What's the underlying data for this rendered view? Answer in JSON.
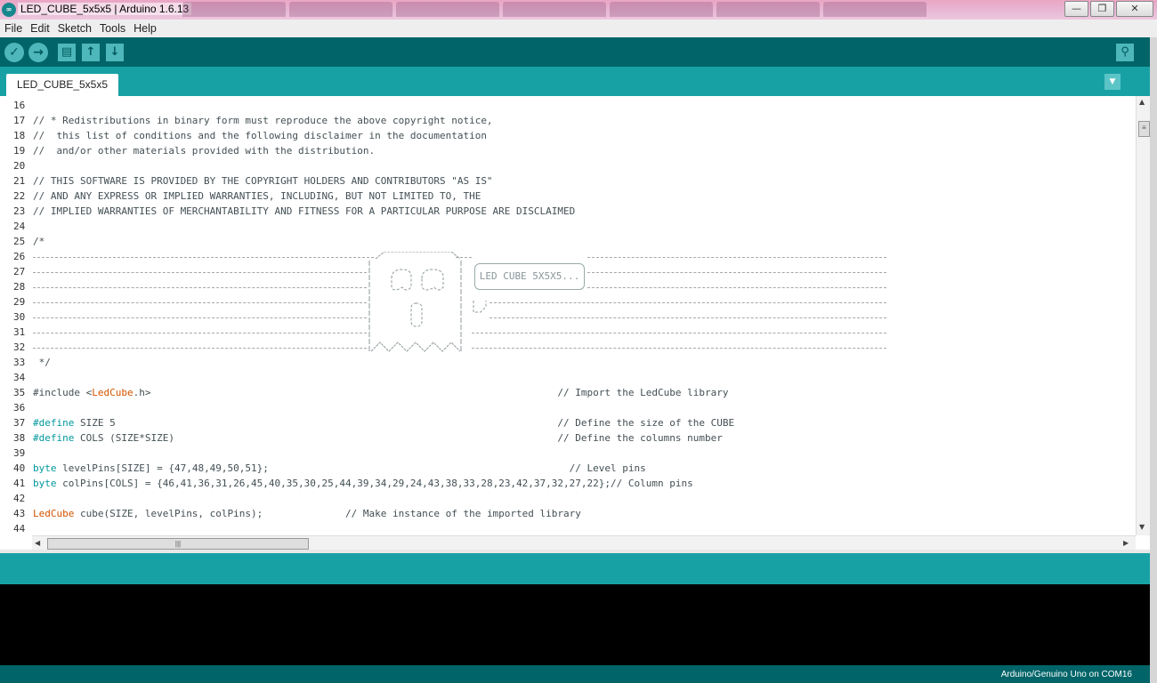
{
  "window": {
    "title": "LED_CUBE_5x5x5 | Arduino 1.6.13",
    "minimize": "—",
    "maximize": "❐",
    "close": "✕",
    "app_icon": "∞"
  },
  "menu": [
    "File",
    "Edit",
    "Sketch",
    "Tools",
    "Help"
  ],
  "toolbar": {
    "verify": "✓",
    "upload": "→",
    "new": "▤",
    "open": "↑",
    "save": "↓",
    "serial_monitor": "⚲"
  },
  "tab": {
    "label": "LED_CUBE_5x5x5",
    "menu_arrow": "▼"
  },
  "editor": {
    "banner": "LED CUBE 5X5X5...",
    "lines": [
      {
        "num": "16",
        "code": ""
      },
      {
        "num": "17",
        "code": "// * Redistributions in binary form must reproduce the above copyright notice,"
      },
      {
        "num": "18",
        "code": "//  this list of conditions and the following disclaimer in the documentation"
      },
      {
        "num": "19",
        "code": "//  and/or other materials provided with the distribution."
      },
      {
        "num": "20",
        "code": ""
      },
      {
        "num": "21",
        "code": "// THIS SOFTWARE IS PROVIDED BY THE COPYRIGHT HOLDERS AND CONTRIBUTORS \"AS IS\""
      },
      {
        "num": "22",
        "code": "// AND ANY EXPRESS OR IMPLIED WARRANTIES, INCLUDING, BUT NOT LIMITED TO, THE"
      },
      {
        "num": "23",
        "code": "// IMPLIED WARRANTIES OF MERCHANTABILITY AND FITNESS FOR A PARTICULAR PURPOSE ARE DISCLAIMED"
      },
      {
        "num": "24",
        "code": ""
      },
      {
        "num": "25",
        "code": "/*"
      },
      {
        "num": "26",
        "code": ""
      },
      {
        "num": "27",
        "code": ""
      },
      {
        "num": "28",
        "code": ""
      },
      {
        "num": "29",
        "code": ""
      },
      {
        "num": "30",
        "code": ""
      },
      {
        "num": "31",
        "code": ""
      },
      {
        "num": "32",
        "code": ""
      },
      {
        "num": "33",
        "code": " */"
      },
      {
        "num": "34",
        "code": ""
      },
      {
        "num": "35",
        "pre": "#include <",
        "kw2": "LedCube",
        "post": ".h>                                                                     // Import the LedCube library"
      },
      {
        "num": "36",
        "code": ""
      },
      {
        "num": "37",
        "kw": "#define",
        "post": " SIZE 5                                                                           // Define the size of the CUBE"
      },
      {
        "num": "38",
        "kw": "#define",
        "post": " COLS (SIZE*SIZE)                                                                 // Define the columns number"
      },
      {
        "num": "39",
        "code": ""
      },
      {
        "num": "40",
        "kw": "byte",
        "post": " levelPins[SIZE] = {47,48,49,50,51};                                                   // Level pins"
      },
      {
        "num": "41",
        "kw": "byte",
        "post": " colPins[COLS] = {46,41,36,31,26,45,40,35,30,25,44,39,34,29,24,43,38,33,28,23,42,37,32,27,22};// Column pins"
      },
      {
        "num": "42",
        "code": ""
      },
      {
        "num": "43",
        "kw2": "LedCube",
        "post": " cube(SIZE, levelPins, colPins);              // Make instance of the imported library"
      },
      {
        "num": "44",
        "code": ""
      }
    ]
  },
  "scrollbar": {
    "up": "▲",
    "down": "▼",
    "left": "◀",
    "right": "▶",
    "grip": "≡",
    "hgrip": "|||"
  },
  "status": {
    "board": "Arduino/Genuino Uno on COM16"
  },
  "colors": {
    "teal_dark": "#006468",
    "teal": "#17a1a5",
    "keyword": "#00979c",
    "type": "#d35400"
  }
}
